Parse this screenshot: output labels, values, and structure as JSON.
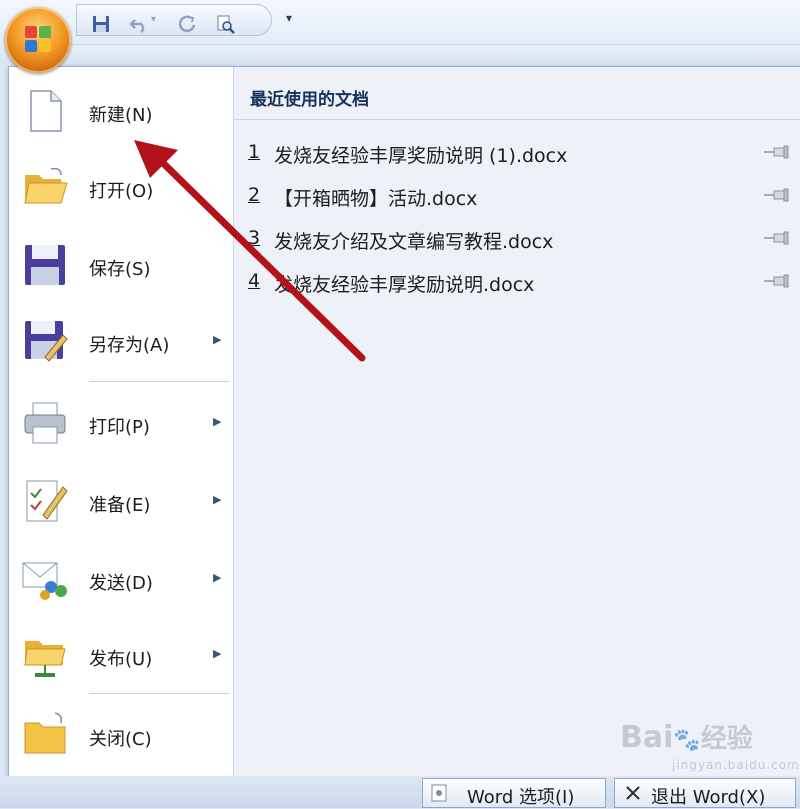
{
  "quick_access": {
    "icons": [
      "office-logo-icon",
      "save-icon",
      "undo-icon",
      "redo-icon",
      "print-preview-icon",
      "customize-dropdown-icon"
    ],
    "dropdown_glyph": "▾"
  },
  "menu": {
    "items": [
      {
        "id": "new",
        "label": "新建(N)",
        "icon": "new-document-icon",
        "submenu": false
      },
      {
        "id": "open",
        "label": "打开(O)",
        "icon": "open-folder-icon",
        "submenu": false
      },
      {
        "id": "save",
        "label": "保存(S)",
        "icon": "floppy-disk-icon",
        "submenu": false
      },
      {
        "id": "save-as",
        "label": "另存为(A)",
        "icon": "save-as-icon",
        "submenu": true
      },
      {
        "id": "print",
        "label": "打印(P)",
        "icon": "printer-icon",
        "submenu": true
      },
      {
        "id": "prepare",
        "label": "准备(E)",
        "icon": "prepare-document-icon",
        "submenu": true
      },
      {
        "id": "send",
        "label": "发送(D)",
        "icon": "send-mail-icon",
        "submenu": true
      },
      {
        "id": "publish",
        "label": "发布(U)",
        "icon": "publish-folder-icon",
        "submenu": true
      },
      {
        "id": "close",
        "label": "关闭(C)",
        "icon": "close-folder-icon",
        "submenu": false
      }
    ],
    "submenu_arrow": "▶"
  },
  "recent": {
    "title": "最近使用的文档",
    "documents": [
      {
        "num": "1",
        "name": "发烧友经验丰厚奖励说明 (1).docx"
      },
      {
        "num": "2",
        "name": "【开箱晒物】活动.docx"
      },
      {
        "num": "3",
        "name": "发烧友介绍及文章编写教程.docx"
      },
      {
        "num": "4",
        "name": "发烧友经验丰厚奖励说明.docx"
      }
    ]
  },
  "bottom_bar": {
    "options_label": "Word 选项(I)",
    "exit_label": "退出 Word(X)"
  },
  "watermark": {
    "brand": "Bai",
    "brand2": "经验",
    "sub": "jingyan.baidu.com"
  },
  "colors": {
    "office_orange": "#f39a26",
    "annotation_red": "#b3121b",
    "title_blue": "#15325c"
  }
}
